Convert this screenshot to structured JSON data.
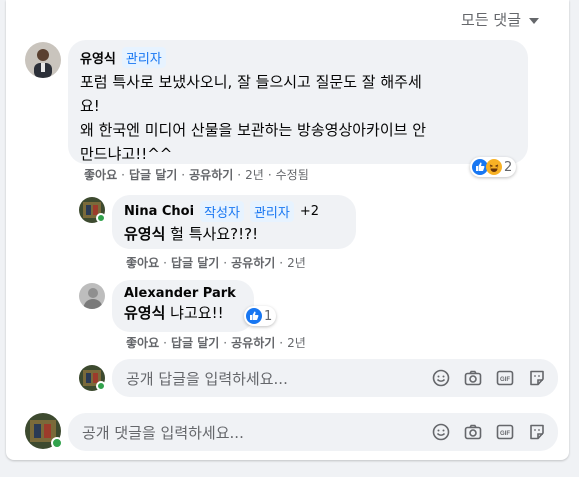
{
  "sort": {
    "label": "모든 댓글"
  },
  "comments": [
    {
      "author": "유영식",
      "badges": [
        "관리자"
      ],
      "lines": [
        "포럼 특사로 보냈사오니, 잘 들으시고 질문도 잘 해주세",
        "요!",
        "왜 한국엔 미디어 산물을 보관하는 방송영상아카이브 안",
        "만드냐고!!^^"
      ],
      "actions": {
        "like": "좋아요",
        "reply": "답글 달기",
        "share": "공유하기",
        "time": "2년",
        "edited": "수정됨"
      },
      "reactions": {
        "icons": [
          "like-icon",
          "haha-icon"
        ],
        "count": "2"
      }
    }
  ],
  "replies": [
    {
      "author": "Nina Choi",
      "badges": [
        "작성자",
        "관리자"
      ],
      "more": "+2",
      "mention": "유영식",
      "text": " 헐 특사요?!?!",
      "actions": {
        "like": "좋아요",
        "reply": "답글 달기",
        "share": "공유하기",
        "time": "2년"
      }
    },
    {
      "author": "Alexander Park",
      "mention": "유영식",
      "text": " 냐고요!!",
      "actions": {
        "like": "좋아요",
        "reply": "답글 달기",
        "share": "공유하기",
        "time": "2년"
      },
      "reactions": {
        "icons": [
          "like-icon"
        ],
        "count": "1"
      }
    }
  ],
  "reply_input": {
    "placeholder": "공개 답글을 입력하세요..."
  },
  "comment_input": {
    "placeholder": "공개 댓글을 입력하세요..."
  },
  "toolbar_icons": [
    "emoji-icon",
    "camera-icon",
    "gif-icon",
    "sticker-icon"
  ],
  "colors": {
    "accent": "#1877f2",
    "online": "#31a24c",
    "bubble": "#f0f2f5",
    "muted": "#65676b"
  }
}
